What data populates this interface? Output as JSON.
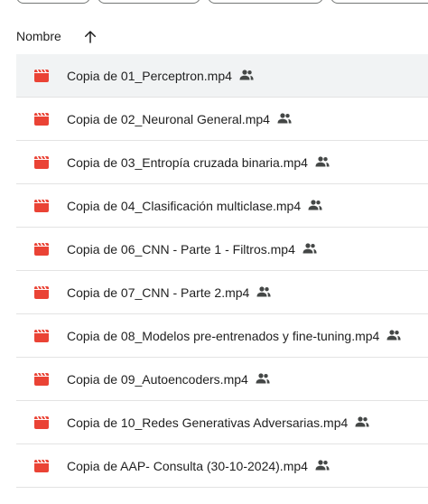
{
  "header": {
    "name_column_label": "Nombre",
    "sort_direction": "ascending",
    "sort_icon": "arrow-up-icon"
  },
  "file_icon": "video-file-icon",
  "shared_icon": "shared-people-icon",
  "colors": {
    "video_icon": "#ea4335",
    "selected_row": "#f1f3f4",
    "divider": "#e3e3e3",
    "text": "#1f1f1f"
  },
  "files": [
    {
      "name": "Copia de 01_Perceptron.mp4",
      "shared": true,
      "selected": true
    },
    {
      "name": "Copia de 02_Neuronal General.mp4",
      "shared": true,
      "selected": false
    },
    {
      "name": "Copia de 03_Entropía cruzada binaria.mp4",
      "shared": true,
      "selected": false
    },
    {
      "name": "Copia de 04_Clasificación multiclase.mp4",
      "shared": true,
      "selected": false
    },
    {
      "name": "Copia de 06_CNN - Parte 1 - Filtros.mp4",
      "shared": true,
      "selected": false
    },
    {
      "name": "Copia de 07_CNN - Parte 2.mp4",
      "shared": true,
      "selected": false
    },
    {
      "name": "Copia de 08_Modelos pre-entrenados y fine-tuning.mp4",
      "shared": true,
      "selected": false
    },
    {
      "name": "Copia de 09_Autoencoders.mp4",
      "shared": true,
      "selected": false
    },
    {
      "name": "Copia de 10_Redes Generativas Adversarias.mp4",
      "shared": true,
      "selected": false
    },
    {
      "name": "Copia de AAP- Consulta (30-10-2024).mp4",
      "shared": true,
      "selected": false
    }
  ]
}
